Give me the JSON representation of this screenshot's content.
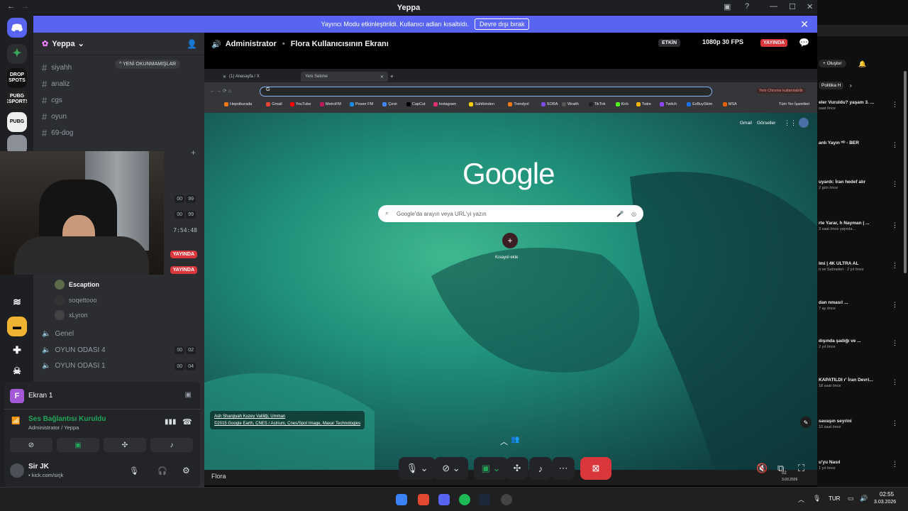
{
  "window": {
    "title": "Yeppa"
  },
  "banner": {
    "text": "Yayıncı Modu etkinleştirildi. Kullanıcı adları kısaltıldı.",
    "button": "Devre dışı bırak"
  },
  "guilds": [
    "DROP SPOTS",
    "PUBG ESPORTS",
    "PUBG"
  ],
  "server": {
    "name": "Yeppa"
  },
  "channels": [
    {
      "name": "siyahh"
    },
    {
      "name": "analiz"
    },
    {
      "name": "cgs"
    },
    {
      "name": "oyun"
    },
    {
      "name": "69-dog"
    }
  ],
  "unread_label": "YENİ OKUNMAMIŞLAR",
  "voice_counts": [
    {
      "a": "00",
      "b": "99"
    },
    {
      "a": "00",
      "b": "99"
    }
  ],
  "timer": "7:54:48",
  "live_badge": "YAYINDA",
  "voice_users": [
    {
      "name": "Escaption"
    },
    {
      "name": "soqettooo"
    },
    {
      "name": "xLyron"
    }
  ],
  "voice_channels": [
    {
      "name": "Genel",
      "a": "",
      "b": ""
    },
    {
      "name": "OYUN ODASI 4",
      "a": "00",
      "b": "02"
    },
    {
      "name": "OYUN ODASI 1",
      "a": "00",
      "b": "04"
    }
  ],
  "screen_panel": {
    "initial": "F",
    "label": "Ekran 1"
  },
  "connection": {
    "status": "Ses Bağlantısı Kuruldu",
    "detail": "Administrator / Yeppa"
  },
  "me": {
    "name": "Sir JK",
    "status": "• kick.com/sirjk"
  },
  "stream": {
    "channel": "Administrator",
    "title": "Flora Kullanıcısının Ekranı",
    "badge_active": "ETKİN",
    "quality": "1080p 30 FPS",
    "live": "YAYINDA"
  },
  "browser": {
    "tabs": [
      "(1) Anasayfa / X",
      "Yeni Sekme"
    ],
    "omnibox_letter": "G",
    "new_chrome": "Yeni Chrome kullanılabilir",
    "bookmarks": [
      "Hepsiburada",
      "Gmail",
      "YouTube",
      "MetroFM",
      "Power FM",
      "Çevir",
      "CapCut",
      "Instagram",
      "Sahibinden",
      "Trendyol",
      "SORA",
      "Wraith",
      "TikTok",
      "Kick",
      "Twire",
      "Twitch",
      "EzBuySkim",
      "MSA"
    ],
    "all_bookmarks": "Tüm Yer İşaretleri",
    "gmail": "Gmail",
    "images": "Görseller",
    "logo": "Google",
    "search_placeholder": "Google'da arayın veya URL'yi yazın",
    "shortcut": "Kısayol ekle",
    "credit_line1": "Ash Sharqiyah Kuzey Valiliği, Umman",
    "credit_line2": "©2015 Google Earth, CNES / Astrium, Cnes/Spot Image, Maxar Technologies",
    "taskbar_label": "Flora",
    "time": "02",
    "date": "3.03.2026"
  },
  "right_panel": {
    "create": "Oluştur",
    "chip": "Politika H",
    "items": [
      {
        "title": "eler Vuruldu? yaşam 3. ...",
        "meta": "saat önce"
      },
      {
        "title": "anlı Yayın ᴴᴰ - BER",
        "meta": ""
      },
      {
        "title": "uyardı: İran hedef alır",
        "meta": "2 gün önce"
      },
      {
        "title": "rte Yarar, h Nayman | ...",
        "meta": "3 saat önce yayınla..."
      },
      {
        "title": "lmi | 4K ULTRA AL",
        "meta": "ri ve Sahneleri · 2 yıl önce"
      },
      {
        "title": "dan nması! ...",
        "meta": "7 ay önce"
      },
      {
        "title": "dışında şadığı ve ...",
        "meta": "2 yıl önce"
      },
      {
        "title": "KAPATILDI r' İran Devri...",
        "meta": "18 saat önce"
      },
      {
        "title": "savaşın seyrini",
        "meta": "10 saat önce"
      },
      {
        "title": "u'yu Nasıl",
        "meta": "1 yıl önce"
      }
    ]
  },
  "taskbar": {
    "lang": "TUR",
    "time": "02:55",
    "date": "3.03.2026"
  },
  "colors": {
    "discord_blurple": "#5865f2",
    "live_red": "#da373c",
    "leave_red": "#da373c"
  }
}
